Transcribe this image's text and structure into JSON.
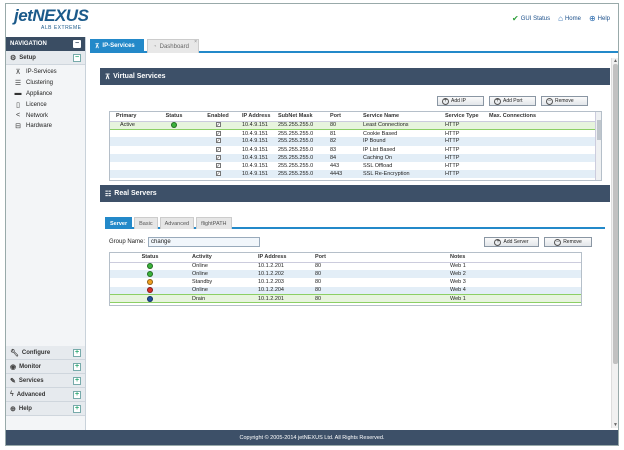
{
  "header": {
    "logo_text": "jetNEXUS",
    "logo_sub": "ALB EXTREME",
    "links": [
      {
        "label": "GUI Status",
        "icon": "check-circle-icon"
      },
      {
        "label": "Home",
        "icon": "home-icon"
      },
      {
        "label": "Help",
        "icon": "lifebuoy-icon"
      }
    ]
  },
  "nav": {
    "title": "NAVIGATION",
    "setup_label": "Setup",
    "setup_items": [
      {
        "label": "IP-Services",
        "icon": "network-icon"
      },
      {
        "label": "Clustering",
        "icon": "server-stack-icon"
      },
      {
        "label": "Appliance",
        "icon": "appliance-icon"
      },
      {
        "label": "Licence",
        "icon": "document-icon"
      },
      {
        "label": "Network",
        "icon": "share-icon"
      },
      {
        "label": "Hardware",
        "icon": "hardware-icon"
      }
    ],
    "sections": [
      {
        "label": "Configure",
        "icon": "wrench-icon"
      },
      {
        "label": "Monitor",
        "icon": "eye-icon"
      },
      {
        "label": "Services",
        "icon": "tools-icon"
      },
      {
        "label": "Advanced",
        "icon": "lightning-icon"
      },
      {
        "label": "Help",
        "icon": "lifebuoy-icon"
      }
    ]
  },
  "tabs": {
    "active": "IP-Services",
    "inactive": "Dashboard"
  },
  "virtual_services": {
    "title": "Virtual Services",
    "buttons": {
      "add_ip": "Add IP",
      "add_port": "Add Port",
      "remove": "Remove"
    },
    "columns": [
      "Primary",
      "Status",
      "Enabled",
      "IP Address",
      "SubNet Mask",
      "Port",
      "Service Name",
      "Service Type",
      "Max. Connections"
    ],
    "rows": [
      {
        "primary": "Active",
        "status": "green",
        "enabled": true,
        "ip": "10.4.9.151",
        "mask": "255.255.255.0",
        "port": "80",
        "name": "Least Connections",
        "type": "HTTP",
        "max": ""
      },
      {
        "primary": "",
        "status": "",
        "enabled": true,
        "ip": "10.4.9.151",
        "mask": "255.255.255.0",
        "port": "81",
        "name": "Cookie Based",
        "type": "HTTP",
        "max": ""
      },
      {
        "primary": "",
        "status": "",
        "enabled": true,
        "ip": "10.4.9.151",
        "mask": "255.255.255.0",
        "port": "82",
        "name": "IP Bound",
        "type": "HTTP",
        "max": ""
      },
      {
        "primary": "",
        "status": "",
        "enabled": true,
        "ip": "10.4.9.151",
        "mask": "255.255.255.0",
        "port": "83",
        "name": "IP List Based",
        "type": "HTTP",
        "max": ""
      },
      {
        "primary": "",
        "status": "",
        "enabled": true,
        "ip": "10.4.9.151",
        "mask": "255.255.255.0",
        "port": "84",
        "name": "Caching On",
        "type": "HTTP",
        "max": ""
      },
      {
        "primary": "",
        "status": "",
        "enabled": true,
        "ip": "10.4.9.151",
        "mask": "255.255.255.0",
        "port": "443",
        "name": "SSL Offload",
        "type": "HTTP",
        "max": ""
      },
      {
        "primary": "",
        "status": "",
        "enabled": true,
        "ip": "10.4.9.151",
        "mask": "255.255.255.0",
        "port": "4443",
        "name": "SSL Re-Encryption",
        "type": "HTTP",
        "max": ""
      }
    ]
  },
  "real_servers": {
    "title": "Real Servers",
    "tabs": [
      "Server",
      "Basic",
      "Advanced",
      "flightPATH"
    ],
    "group_label": "Group Name:",
    "group_value": "change",
    "buttons": {
      "add_server": "Add Server",
      "remove": "Remove"
    },
    "columns": [
      "Status",
      "Activity",
      "IP Address",
      "Port",
      "Notes"
    ],
    "rows": [
      {
        "status": "green",
        "activity": "Online",
        "ip": "10.1.2.201",
        "port": "80",
        "notes": "Web 1"
      },
      {
        "status": "green",
        "activity": "Online",
        "ip": "10.1.2.202",
        "port": "80",
        "notes": "Web 2"
      },
      {
        "status": "orange",
        "activity": "Standby",
        "ip": "10.1.2.203",
        "port": "80",
        "notes": "Web 3"
      },
      {
        "status": "red",
        "activity": "Online",
        "ip": "10.1.2.204",
        "port": "80",
        "notes": "Web 4"
      },
      {
        "status": "blue",
        "activity": "Drain",
        "ip": "10.1.2.201",
        "port": "80",
        "notes": "Web 1"
      }
    ]
  },
  "status_colors": {
    "green": "#3bb33b",
    "orange": "#f0a020",
    "red": "#d8302a",
    "blue": "#1f4f9e"
  },
  "footer": "Copyright © 2005-2014 jetNEXUS Ltd. All Rights Reserved."
}
